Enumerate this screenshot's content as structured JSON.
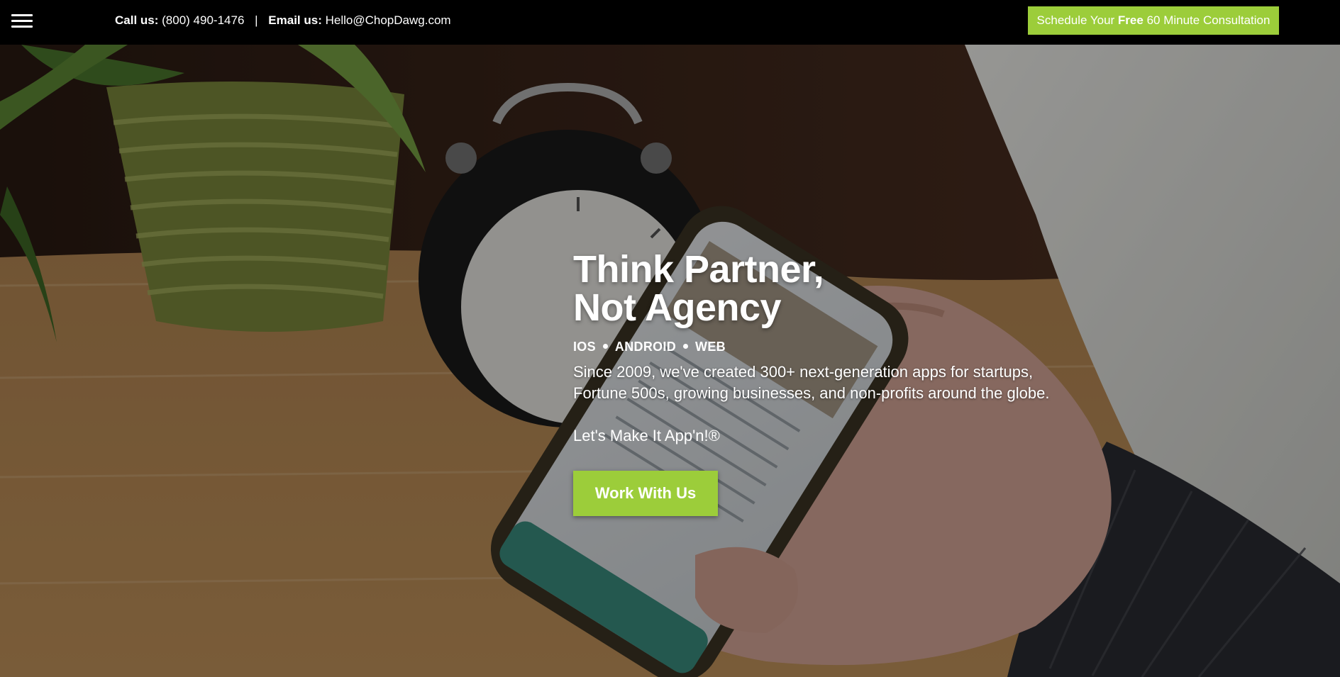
{
  "topbar": {
    "call_label": "Call us:",
    "phone": "(800) 490-1476",
    "separator": "|",
    "email_label": "Email us:",
    "email": "Hello@ChopDawg.com",
    "cta_prefix": "Schedule Your ",
    "cta_bold": "Free",
    "cta_suffix": " 60 Minute Consultation",
    "accent_color": "#9ccd3a",
    "menu_icon": "hamburger-menu-icon"
  },
  "hero": {
    "headline_line1": "Think Partner,",
    "headline_line2": "Not Agency",
    "platforms": [
      "IOS",
      "ANDROID",
      "WEB"
    ],
    "description": "Since 2009, we've created 300+ next-generation apps for startups, Fortune 500s, growing businesses, and non-profits around the globe.",
    "tagline": "Let's Make It App'n!®",
    "button_label": "Work With Us",
    "background": "photo of hand holding smartphone on wooden desk with alarm clock and potted plant"
  }
}
